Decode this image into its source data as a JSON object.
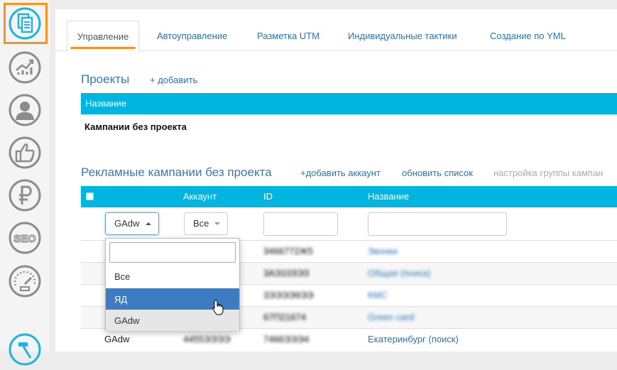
{
  "sidebar": {
    "items": [
      {
        "icon": "documents-icon",
        "active": true
      },
      {
        "icon": "growth-chart-icon"
      },
      {
        "icon": "user-icon"
      },
      {
        "icon": "thumbs-up-icon"
      },
      {
        "icon": "ruble-icon"
      },
      {
        "icon": "seo-icon",
        "label": "SEO"
      },
      {
        "icon": "speedometer-icon"
      },
      {
        "icon": "hammer-icon"
      }
    ],
    "accent_color": "#f7941d",
    "icon_color": "#8c8c8c",
    "active_icon_color": "#1fb3e0"
  },
  "tabs": [
    "Управление",
    "Автоуправление",
    "Разметка UTM",
    "Индивидуальные тактики",
    "Создание по YML"
  ],
  "projects": {
    "title": "Проекты",
    "add_link": "+ добавить",
    "column": "Название",
    "row": "Кампании без проекта"
  },
  "campaigns": {
    "title": "Рекламные кампании без проекта",
    "add_account": "+добавить аккаунт",
    "refresh": "обновить список",
    "group_settings": "настройка группы кампан",
    "columns": {
      "account": "Аккаунт",
      "id": "ID",
      "name": "Название"
    },
    "filters": {
      "system": "GAdw",
      "account": "Все"
    },
    "rows": [
      {
        "system": "",
        "account": "",
        "id": "3466772Ж5",
        "name": "Звонки"
      },
      {
        "system": "",
        "account": "",
        "id": "3АЭ10ЗЭЗ",
        "name": "Общая (поиск)"
      },
      {
        "system": "",
        "account": "",
        "id": "3ЭЭЭЭ9ЭЭ",
        "name": "КМС"
      },
      {
        "system": "",
        "account": "",
        "id": "67П21674",
        "name": "Green card"
      },
      {
        "system": "GAdw",
        "account": "4455ЭЭЭЭ",
        "id": "7466ЭЭЭ4",
        "name": "Екатеринбург (поиск)"
      }
    ]
  },
  "dropdown": {
    "search_value": "",
    "options": [
      "Все",
      "ЯД",
      "GAdw"
    ],
    "hovered": "ЯД",
    "selected": "GAdw"
  },
  "colors": {
    "header_bar": "#00b6e0",
    "link": "#2a72b5",
    "highlight": "#3d7cc0"
  }
}
